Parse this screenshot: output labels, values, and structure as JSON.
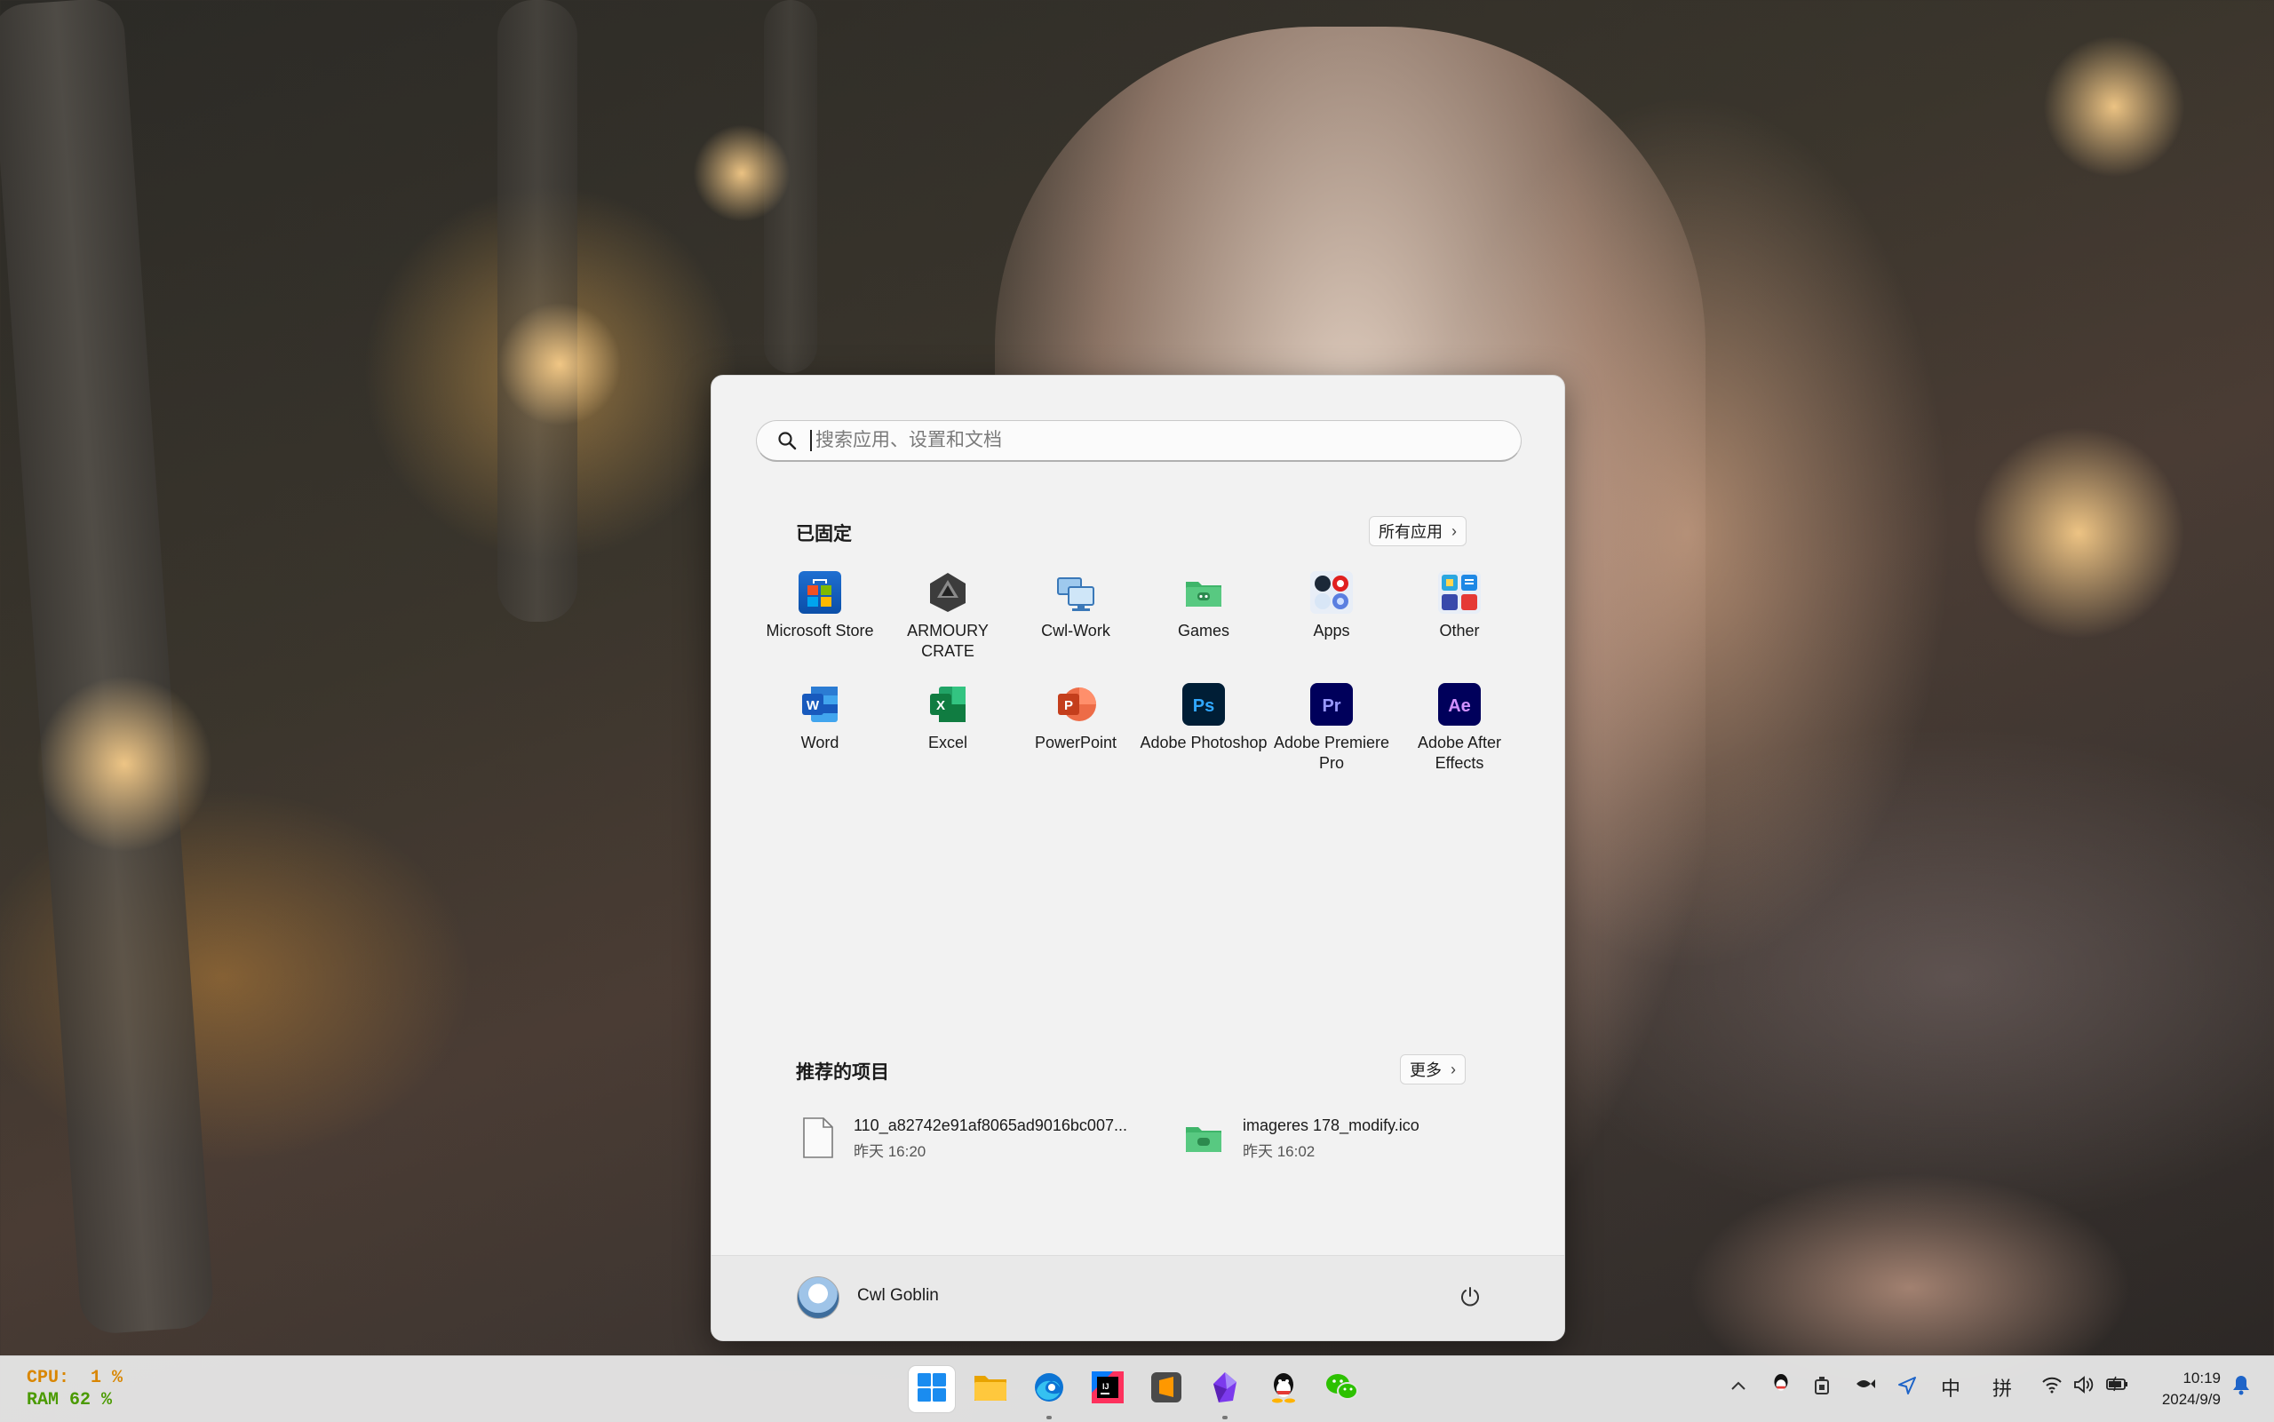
{
  "search": {
    "placeholder": "搜索应用、设置和文档"
  },
  "pinned": {
    "title": "已固定",
    "all_apps_label": "所有应用",
    "apps": [
      {
        "label": "Microsoft Store",
        "icon": "microsoft-store-icon"
      },
      {
        "label": "ARMOURY CRATE",
        "icon": "armoury-crate-icon"
      },
      {
        "label": "Cwl-Work",
        "icon": "computer-folder-icon"
      },
      {
        "label": "Games",
        "icon": "green-folder-icon"
      },
      {
        "label": "Apps",
        "icon": "apps-folder-icon"
      },
      {
        "label": "Other",
        "icon": "other-folder-icon"
      },
      {
        "label": "Word",
        "icon": "word-icon"
      },
      {
        "label": "Excel",
        "icon": "excel-icon"
      },
      {
        "label": "PowerPoint",
        "icon": "powerpoint-icon"
      },
      {
        "label": "Adobe Photoshop",
        "icon": "photoshop-icon"
      },
      {
        "label": "Adobe Premiere Pro",
        "icon": "premiere-pro-icon"
      },
      {
        "label": "Adobe After Effects",
        "icon": "after-effects-icon"
      }
    ]
  },
  "recommended": {
    "title": "推荐的项目",
    "more_label": "更多",
    "items": [
      {
        "name": "110_a82742e91af8065ad9016bc007...",
        "time": "昨天 16:20",
        "icon": "file-icon"
      },
      {
        "name": "imageres 178_modify.ico",
        "time": "昨天 16:02",
        "icon": "green-folder-icon"
      }
    ]
  },
  "user": {
    "name": "Cwl Goblin"
  },
  "perf": {
    "cpu_label": "CPU:",
    "cpu_value": "1 %",
    "ram_label": "RAM",
    "ram_value": "62 %"
  },
  "taskbar": {
    "apps": [
      "windows-start-icon",
      "file-explorer-icon",
      "edge-icon",
      "intellij-idea-icon",
      "sublime-text-icon",
      "obsidian-icon",
      "qq-icon",
      "wechat-icon"
    ]
  },
  "tray": {
    "ime_mode": "中",
    "ime_name": "拼",
    "time": "10:19",
    "date": "2024/9/9"
  },
  "colors": {
    "menu_bg": "#f2f2f2",
    "cpu_color": "#d98600",
    "ram_color": "#4a9a00",
    "word_blue": "#185abd",
    "excel_green": "#107c41",
    "ppt_orange": "#c43e1c",
    "adobe_dark": "#001e36"
  }
}
